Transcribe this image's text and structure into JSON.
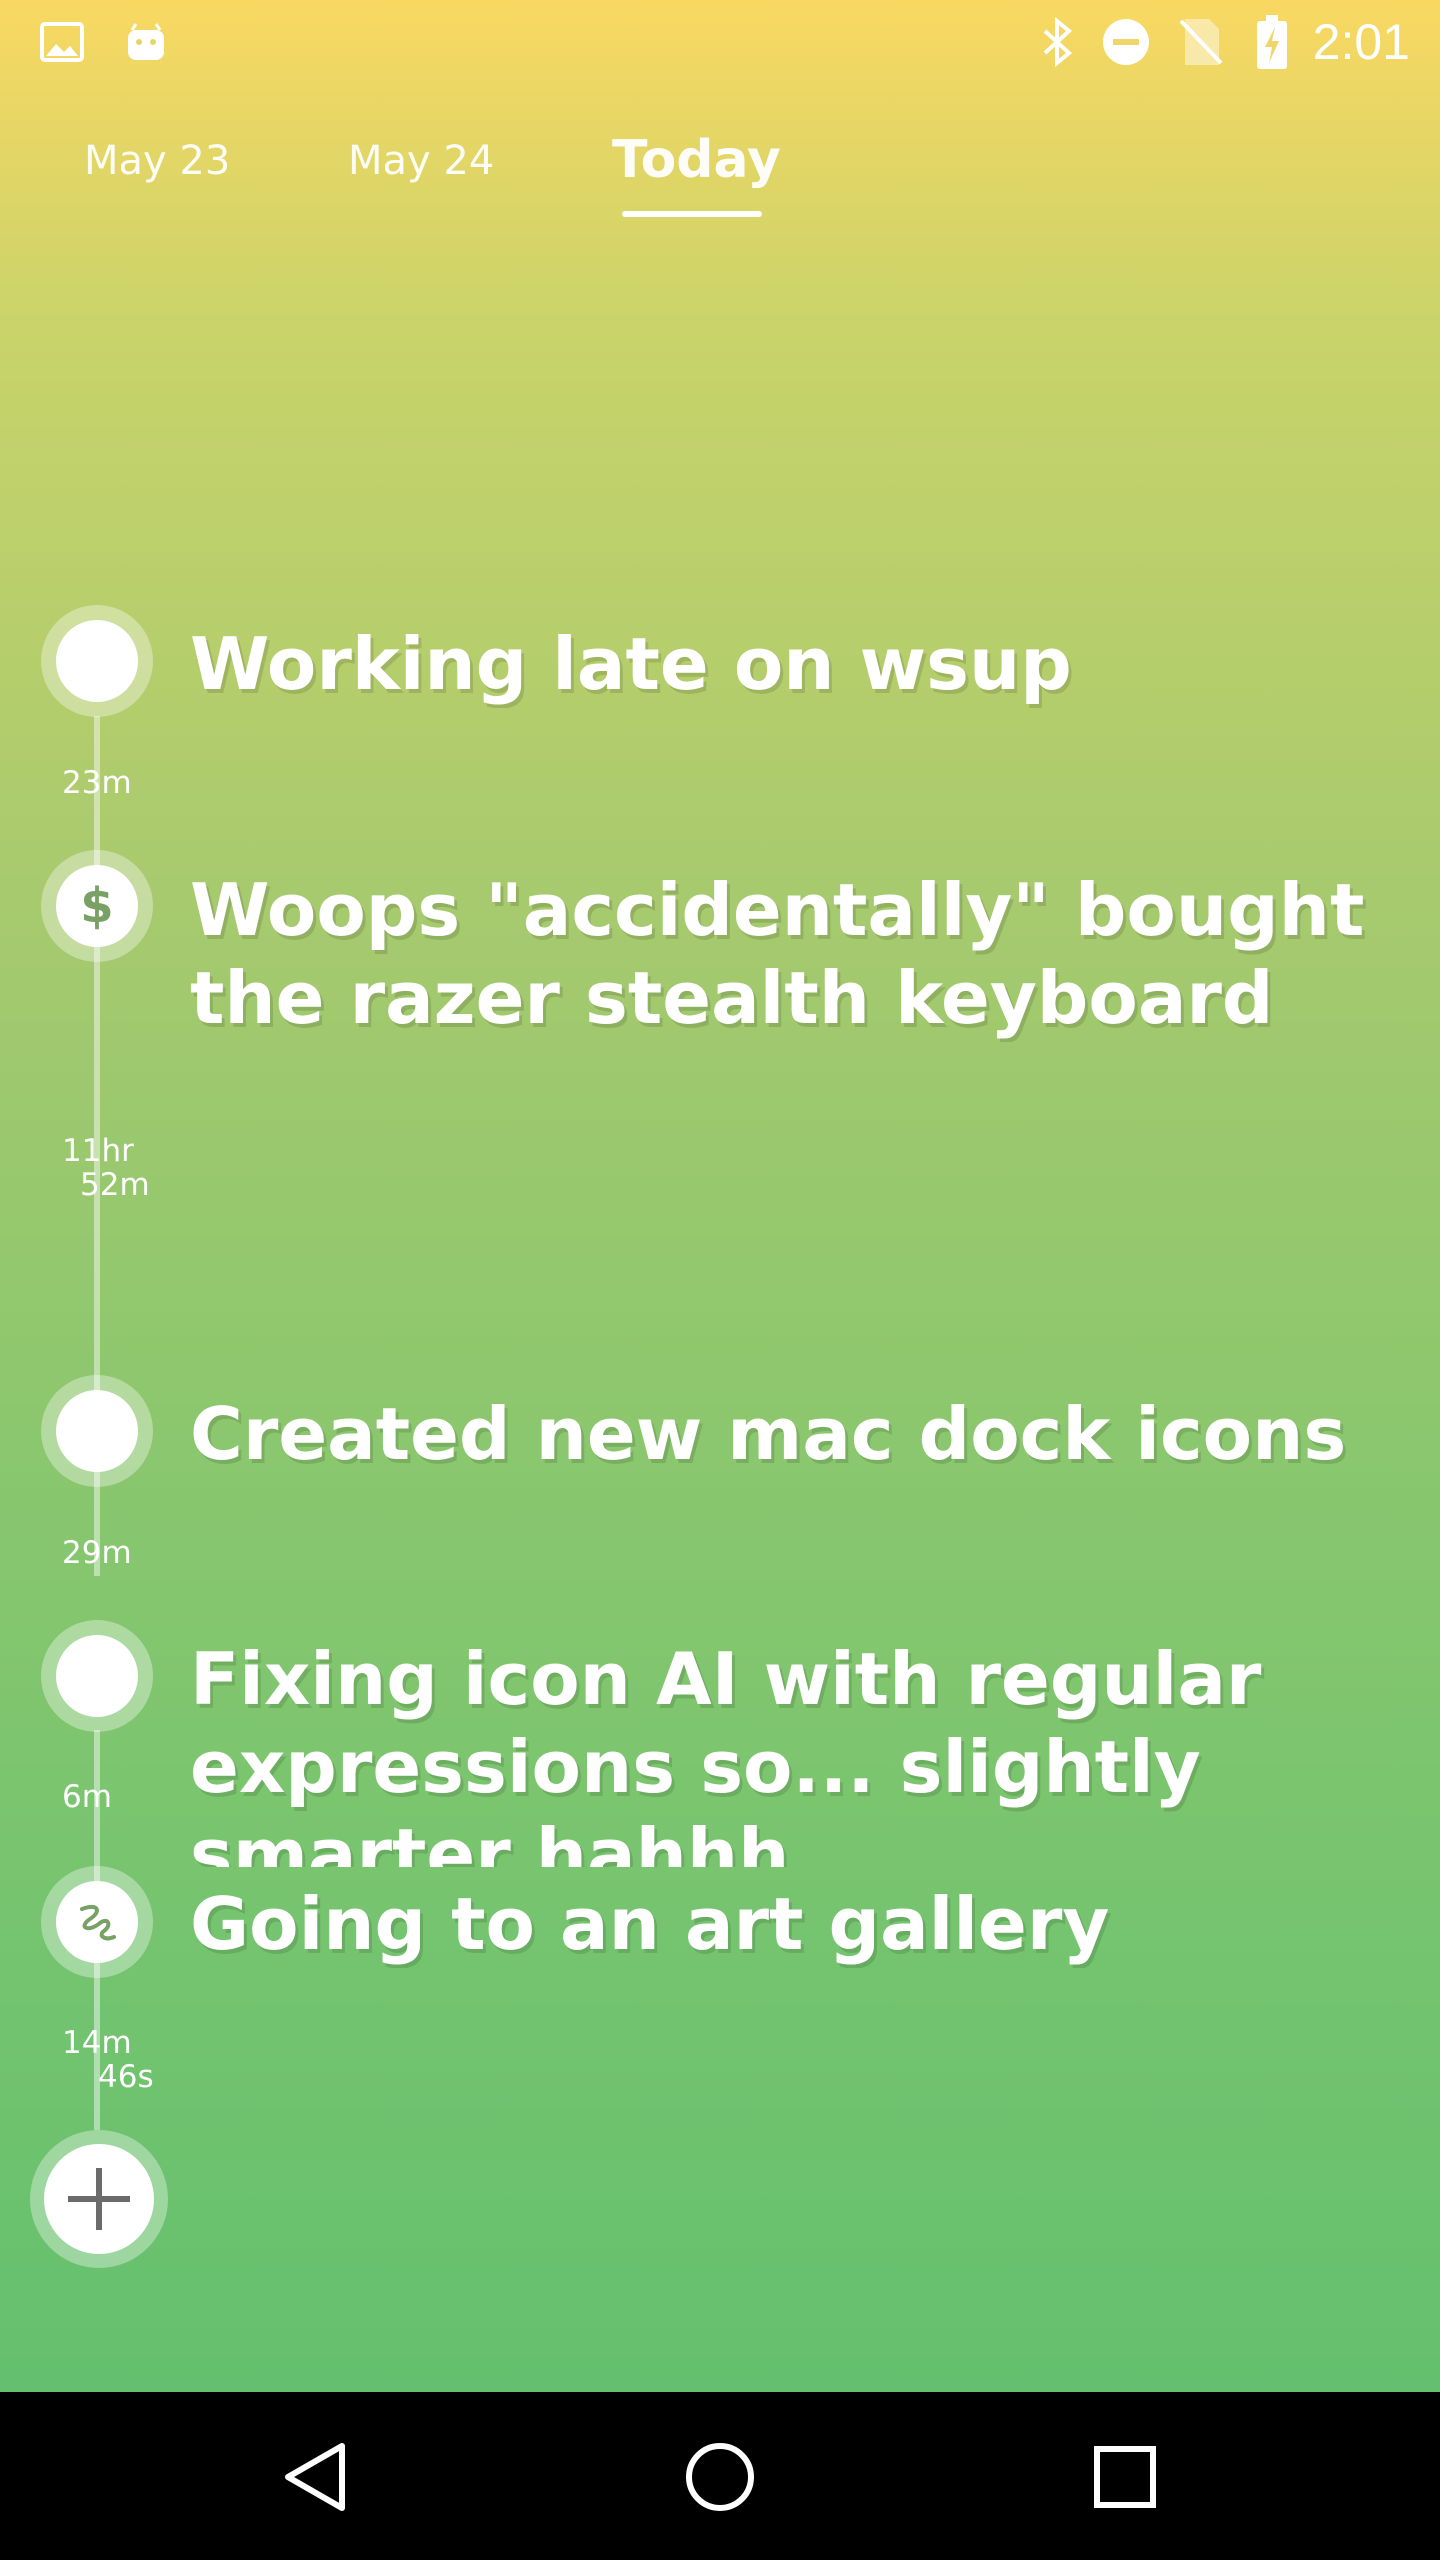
{
  "status_bar": {
    "time": "2:01",
    "left_icons": [
      "image-icon",
      "android-icon"
    ],
    "right_icons": [
      "bluetooth-icon",
      "do-not-disturb-icon",
      "no-sim-icon",
      "battery-charging-icon"
    ]
  },
  "tabs": [
    {
      "label": "May 23",
      "active": false
    },
    {
      "label": "May 24",
      "active": false
    },
    {
      "label": "Today",
      "active": true
    }
  ],
  "timeline": {
    "entries": [
      {
        "text": "Working late on wsup",
        "icon": "empty-dot"
      },
      {
        "text": "Woops \"accidentally\" bought the razer stealth keyboard",
        "icon": "dollar-icon",
        "icon_glyph": "$"
      },
      {
        "text": "Created new mac dock icons",
        "icon": "empty-dot"
      },
      {
        "text": "Fixing icon AI with regular expressions so... slightly smarter hahhh",
        "icon": "empty-dot"
      },
      {
        "text": "Going to an art gallery",
        "icon": "squiggle-icon"
      }
    ],
    "durations": [
      {
        "line1": "23m"
      },
      {
        "line1": "11hr",
        "line2": "52m"
      },
      {
        "line1": "29m"
      },
      {
        "line1": "6m"
      },
      {
        "line1": "14m",
        "line2": "46s"
      }
    ]
  },
  "add_button": {
    "icon": "plus-icon"
  },
  "nav_bar": {
    "buttons": [
      "back-icon",
      "home-icon",
      "recents-icon"
    ]
  },
  "colors": {
    "gradient_top": "#f9d862",
    "gradient_bottom": "#64c06e",
    "node_glyph": "#7aa165"
  }
}
